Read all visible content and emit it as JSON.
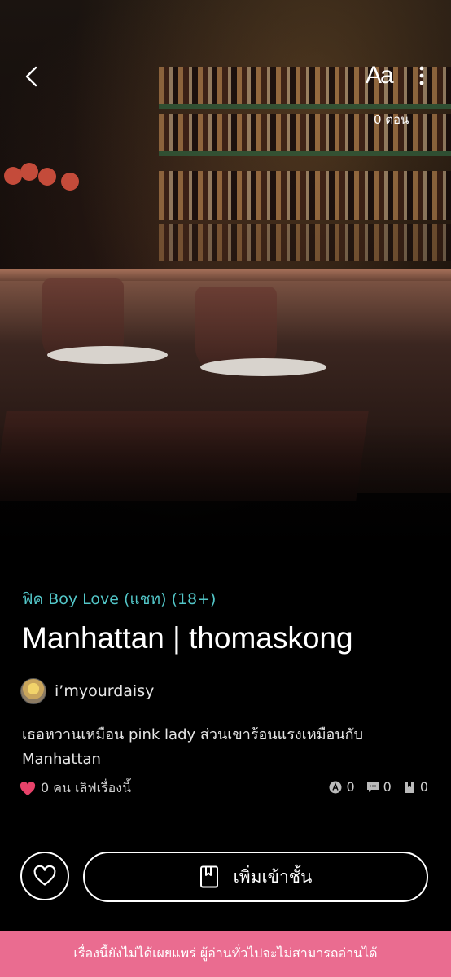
{
  "header": {
    "back_icon": "chevron-left-icon",
    "font_size_label": "Aa",
    "more_icon": "vertical-dots-icon",
    "episodes": "0 ตอน"
  },
  "story": {
    "genre": "ฟิค Boy Love (แชท) (18+)",
    "title": "Manhattan | thomaskong",
    "author": "i’myourdaisy",
    "description": "เธอหวานเหมือน pink lady ส่วนเขาร้อนแรงเหมือนกับ Manhattan",
    "likes": "0 คน เลิฟเรื่องนี้",
    "stats": [
      {
        "icon": "reader-icon",
        "value": "0"
      },
      {
        "icon": "comment-icon",
        "value": "0"
      },
      {
        "icon": "bookmark-icon",
        "value": "0"
      }
    ]
  },
  "actions": {
    "favorite_icon": "heart-outline-icon",
    "add_to_shelf_label": "เพิ่มเข้าชั้น",
    "add_to_shelf_icon": "book-icon"
  },
  "banner": {
    "text": "เรื่องนี้ยังไม่ได้เผยแพร่ ผู้อ่านทั่วไปจะไม่สามารถอ่านได้"
  },
  "colors": {
    "genre": "#53c7c9",
    "heart": "#e8426a",
    "banner_bg": "#ea6c90",
    "background": "#000000"
  }
}
